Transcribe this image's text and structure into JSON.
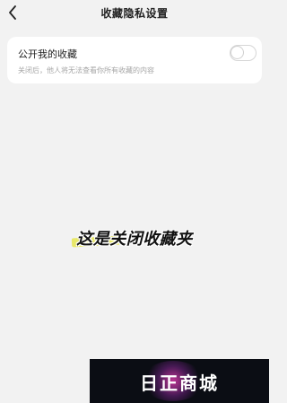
{
  "header": {
    "back_icon": "chevron-left-icon",
    "title": "收藏隐私设置"
  },
  "setting": {
    "title": "公开我的收藏",
    "description": "关闭后，他人将无法查看你所有收藏的内容",
    "toggle_on": false
  },
  "overlay": {
    "caption": "这是关闭收藏夹"
  },
  "watermark": {
    "text": "日正商城"
  },
  "colors": {
    "background": "#f2f2f2",
    "card": "#ffffff",
    "caption_highlight": "#e8e86a",
    "watermark_bg": "#0b0d14"
  }
}
